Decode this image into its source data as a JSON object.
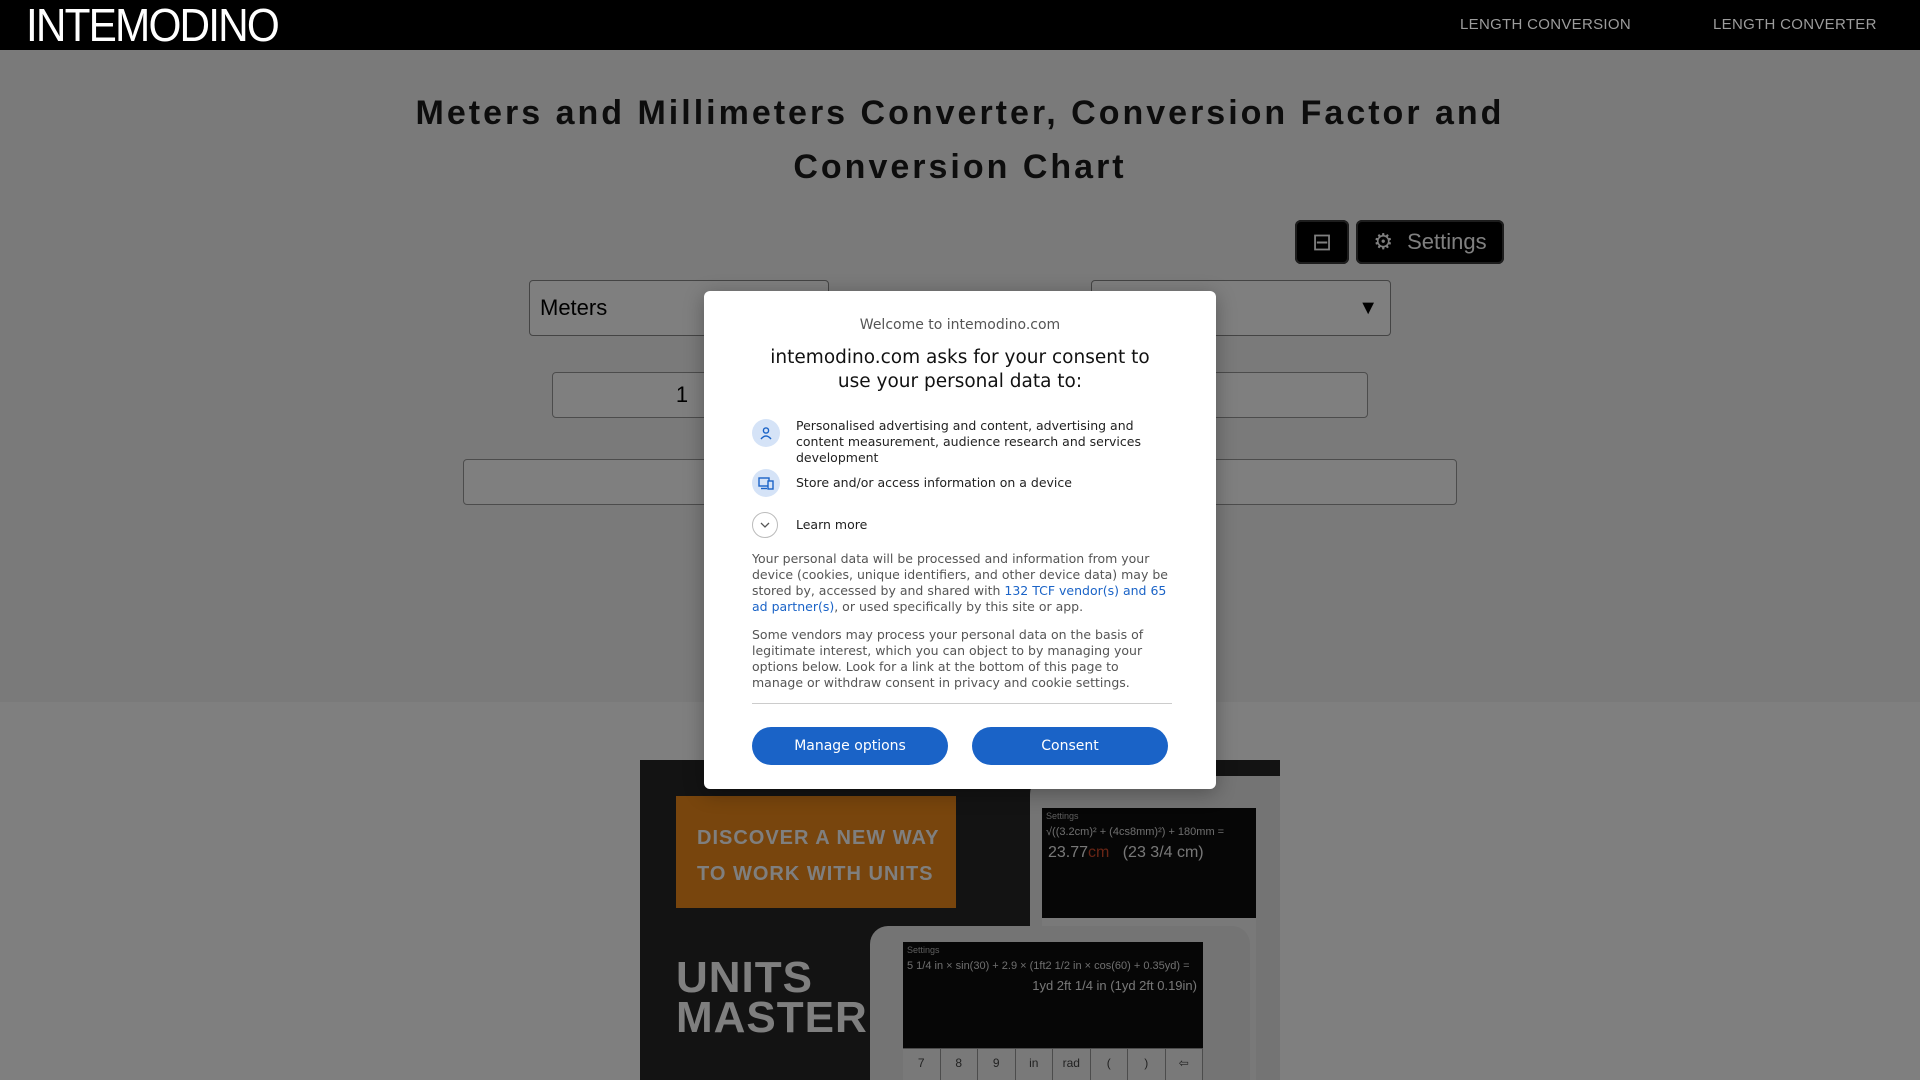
{
  "header": {
    "logo": "INTEMODINO",
    "nav": [
      "LENGTH CONVERSION",
      "LENGTH CONVERTER"
    ]
  },
  "page": {
    "title": "Meters and Millimeters Converter, Conversion Factor and Conversion Chart",
    "toggle_icon": "⊟",
    "settings_icon": "⚙",
    "settings_label": "Settings",
    "from_unit": "Meters",
    "to_unit": "",
    "to_arrow": "▼",
    "from_value": "1"
  },
  "ad": {
    "tagline_line1": "DISCOVER A NEW WAY",
    "tagline_line2": "TO WORK WITH UNITS",
    "brand_line1": "UNITS",
    "brand_line2": "MASTER",
    "back_menu": "Settings",
    "back_expr": "√((3.2cm)² + (4cs8mm)²) + 180mm =",
    "back_result": "23.77",
    "back_result_unit": "cm",
    "back_result_alt": "(23 3/4 cm)",
    "front_menu": "Settings",
    "front_expr": "5 1/4 in × sin(30) + 2.9 × (1ft2 1/2 in × cos(60) + 0.35yd) =",
    "front_result": "1yd 2ft 1/4 in   (1yd 2ft 0.19in)",
    "keys": [
      "7",
      "8",
      "9",
      "in",
      "rad",
      "(",
      ")",
      "⇦"
    ]
  },
  "consent": {
    "welcome": "Welcome to intemodino.com",
    "heading": "intemodino.com asks for your consent to use your personal data to:",
    "purposes": [
      {
        "icon": "person-icon",
        "text": "Personalised advertising and content, advertising and content measurement, audience research and services development"
      },
      {
        "icon": "device-icon",
        "text": "Store and/or access information on a device"
      }
    ],
    "learn_more": "Learn more",
    "para1_before": "Your personal data will be processed and information from your device (cookies, unique identifiers, and other device data) may be stored by, accessed by and shared with ",
    "para1_link": "132 TCF vendor(s) and 65 ad partner(s)",
    "para1_after": ", or used specifically by this site or app.",
    "para2": "Some vendors may process your personal data on the basis of legitimate interest, which you can object to by managing your options below. Look for a link at the bottom of this page to manage or withdraw consent in privacy and cookie settings.",
    "manage_label": "Manage options",
    "consent_label": "Consent",
    "accent_color": "#1a63c7"
  }
}
